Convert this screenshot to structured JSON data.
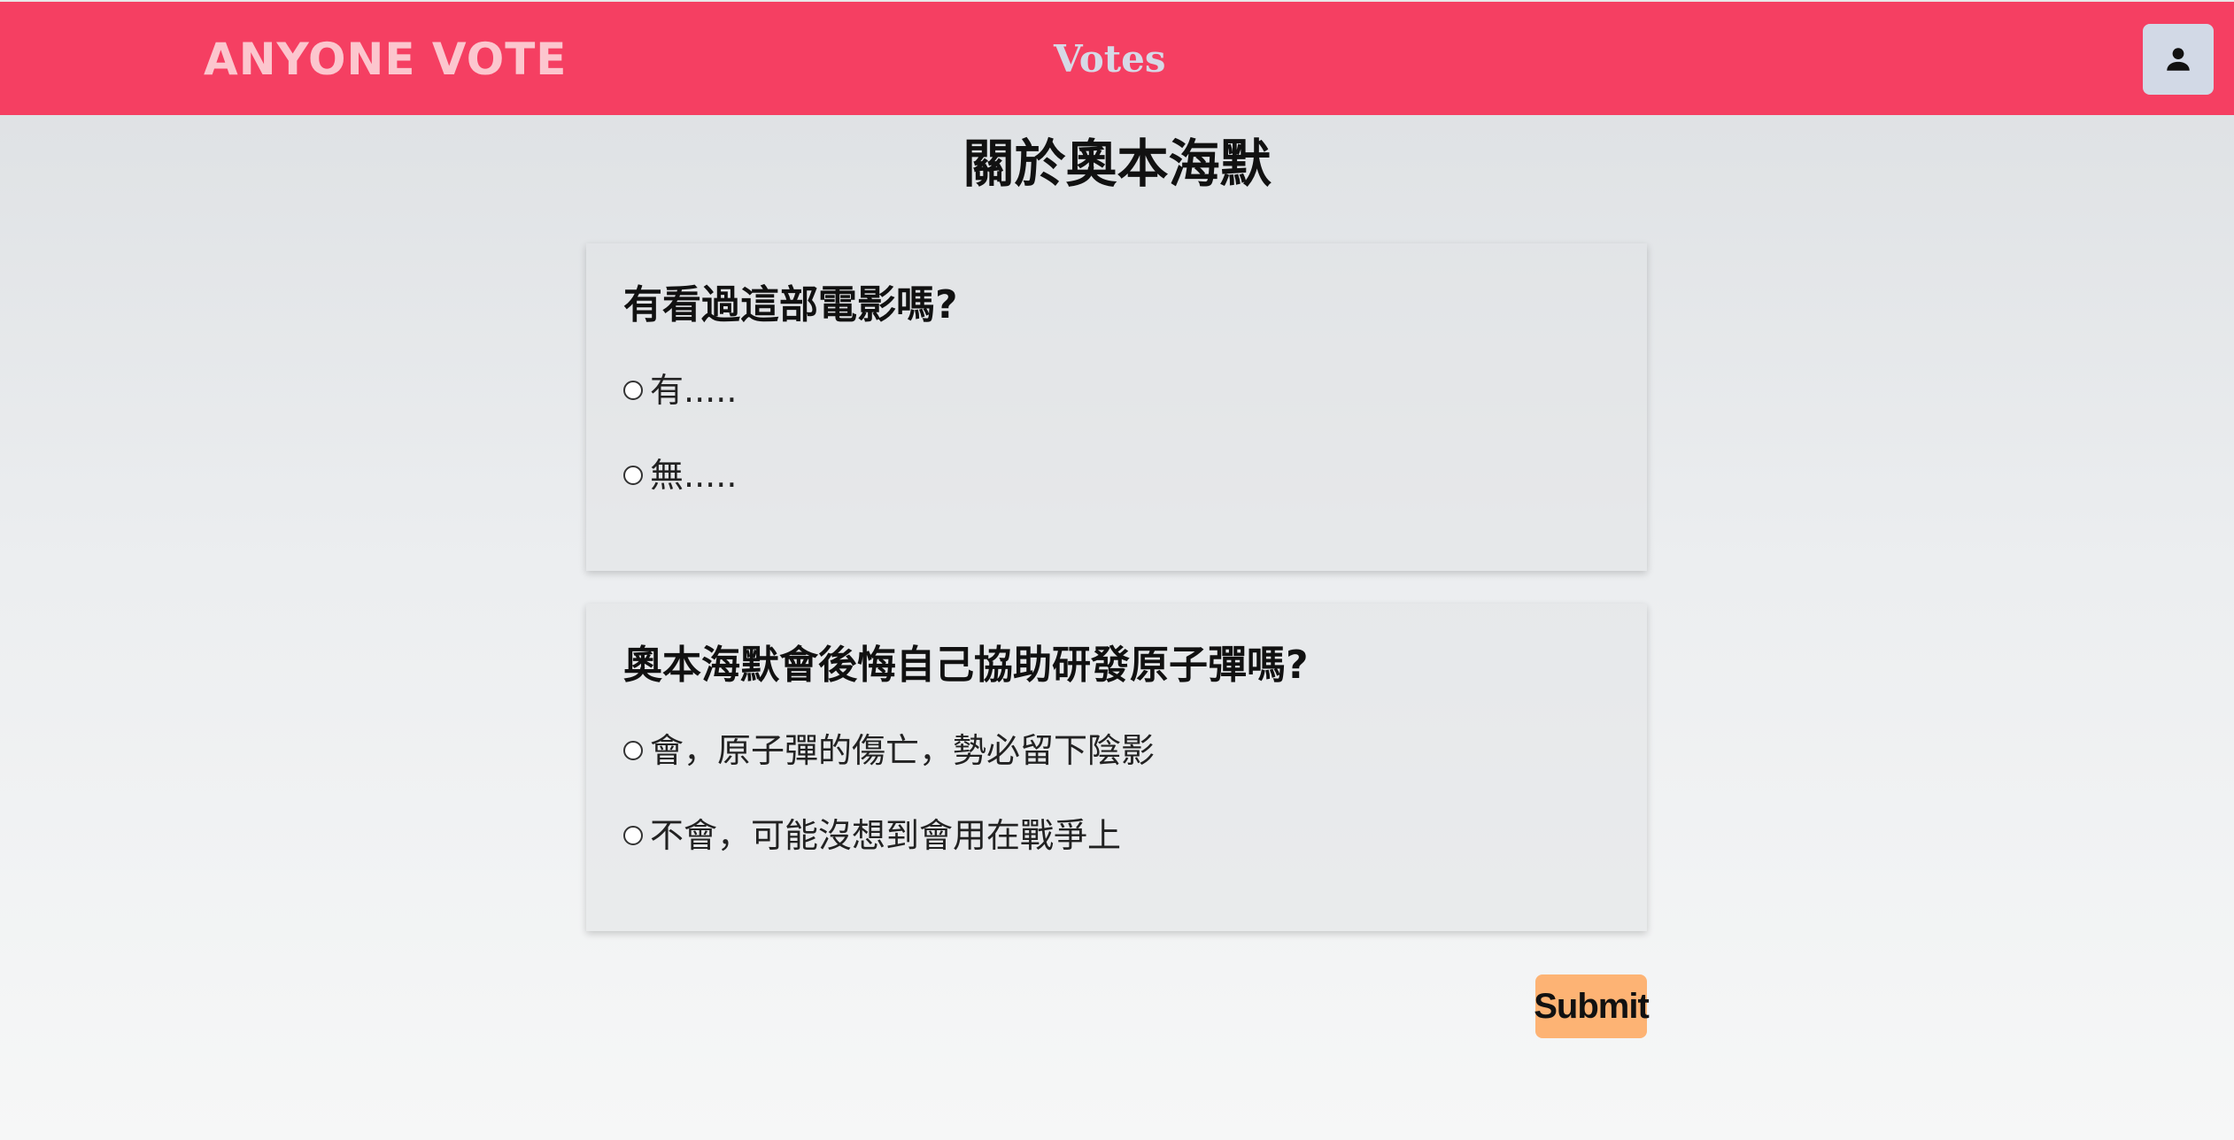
{
  "header": {
    "brand": "ANYONE VOTE",
    "nav_votes": "Votes",
    "account_icon": "user-icon",
    "colors": {
      "bar": "#f53f62",
      "brand": "#fcc6ce",
      "nav": "#d6d9e6",
      "account_bg": "#d2d9e6"
    }
  },
  "page": {
    "title": "關於奧本海默"
  },
  "questions": [
    {
      "text": "有看過這部電影嗎?",
      "options": [
        "有.....",
        "無....."
      ]
    },
    {
      "text": "奧本海默會後悔自己協助研發原子彈嗎?",
      "options": [
        "會，原子彈的傷亡，勢必留下陰影",
        "不會，可能沒想到會用在戰爭上"
      ]
    }
  ],
  "actions": {
    "submit_label": "Submit",
    "submit_color": "#fdb374"
  }
}
